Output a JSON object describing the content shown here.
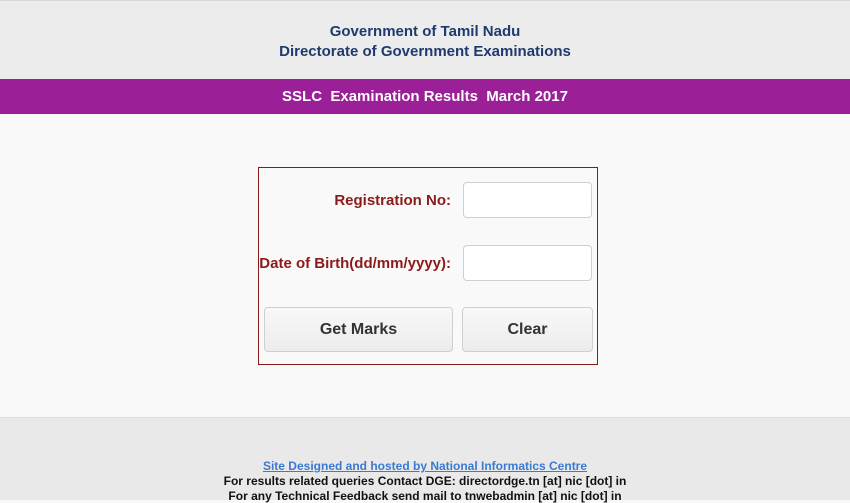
{
  "header": {
    "line1": "Government of Tamil Nadu",
    "line2": "Directorate of Government Examinations"
  },
  "banner": {
    "title": "SSLC  Examination Results  March 2017"
  },
  "form": {
    "registration_label": "Registration No:",
    "registration_value": "",
    "dob_label": "Date of Birth(dd/mm/yyyy):",
    "dob_value": "",
    "get_marks_label": "Get Marks",
    "clear_label": "Clear"
  },
  "footer": {
    "credit_link": "Site Designed and hosted by National Informatics Centre",
    "queries": "For results related queries Contact DGE:  directordge.tn [at] nic [dot] in",
    "feedback": "For any Technical Feedback send mail to tnwebadmin [at] nic [dot] in"
  },
  "colors": {
    "banner": "#9b1f96",
    "header_text": "#1f3a6e",
    "label_text": "#8b1a1a",
    "link": "#3a7ad1"
  }
}
